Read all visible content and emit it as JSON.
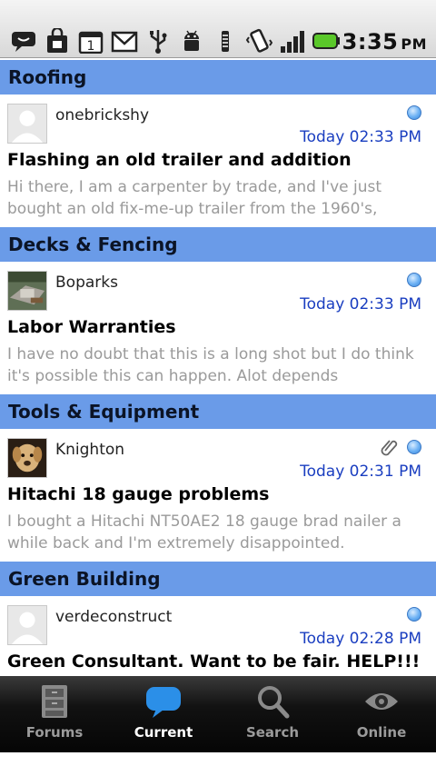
{
  "status_bar": {
    "time": "3:35",
    "ampm": "PM",
    "icons": [
      "chat-bubble-icon",
      "shopping-bag-icon",
      "calendar-icon",
      "gmail-icon",
      "usb-icon",
      "android-debug-icon",
      "wifi-icon",
      "vibrate-icon",
      "signal-icon",
      "battery-icon"
    ]
  },
  "sections": [
    {
      "title": "Roofing",
      "post": {
        "username": "onebrickshy",
        "timestamp": "Today 02:33 PM",
        "title": "Flashing an old trailer and addition",
        "snippet": "Hi there, I am a carpenter by trade, and I've just bought an old fix-me-up trailer from the 1960's,",
        "avatar": "default-avatar",
        "unread": true
      }
    },
    {
      "title": "Decks & Fencing",
      "post": {
        "username": "Boparks",
        "timestamp": "Today 02:33 PM",
        "title": "Labor Warranties",
        "snippet": "I have no doubt that this is a long shot but I do think it's possible this can happen. Alot depends",
        "avatar": "deck-photo-avatar",
        "unread": true
      }
    },
    {
      "title": "Tools &  Equipment",
      "post": {
        "username": "Knighton",
        "timestamp": "Today 02:31 PM",
        "title": "Hitachi 18 gauge problems",
        "snippet": "I bought a Hitachi NT50AE2 18 gauge brad nailer a while back and I'm extremely disappointed.",
        "avatar": "dog-photo-avatar",
        "unread": true,
        "attachment": true
      }
    },
    {
      "title": "Green Building",
      "post": {
        "username": "verdeconstruct",
        "timestamp": "Today 02:28 PM",
        "title": "Green Consultant. Want to be fair. HELP!!!",
        "snippet": "",
        "avatar": "default-avatar",
        "unread": true
      }
    }
  ],
  "tabs": [
    {
      "label": "Forums",
      "icon": "cabinet-icon",
      "active": false
    },
    {
      "label": "Current",
      "icon": "speech-bubble-icon",
      "active": true
    },
    {
      "label": "Search",
      "icon": "search-icon",
      "active": false
    },
    {
      "label": "Online",
      "icon": "eye-icon",
      "active": false
    }
  ],
  "colors": {
    "section_header": "#6a9be8",
    "timestamp": "#1a3ec0",
    "snippet": "#9a9a9a",
    "active_tab_icon": "#2b8fe8"
  }
}
